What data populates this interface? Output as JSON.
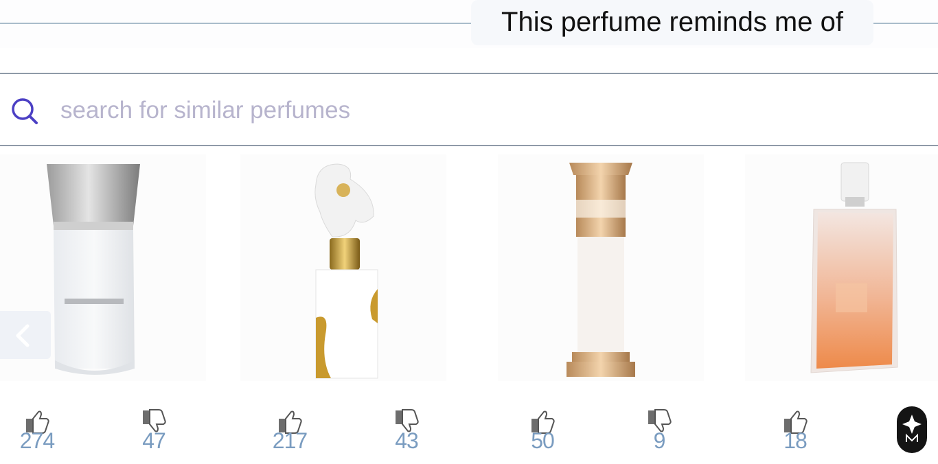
{
  "header": {
    "title": "This perfume reminds me of"
  },
  "search": {
    "placeholder": "search for similar perfumes",
    "value": ""
  },
  "perfumes": [
    {
      "image": "silver-cap-white-bottle",
      "votes": {
        "up": "274",
        "down": "47"
      }
    },
    {
      "image": "statue-gold-bottle",
      "votes": {
        "up": "217",
        "down": "43"
      }
    },
    {
      "image": "gold-pillar-bottle",
      "votes": {
        "up": "50",
        "down": "9"
      }
    },
    {
      "image": "orange-gradient-bottle",
      "votes": {
        "up": "18"
      }
    }
  ],
  "icons": {
    "search": "search-icon",
    "thumbs_up": "thumbs-up-icon",
    "thumbs_down": "thumbs-down-icon",
    "carousel_prev": "chevron-left-icon",
    "brand_logo": "brand-logo-icon"
  },
  "colors": {
    "accent": "#4b3fc4",
    "vote_count": "#7a9cc0",
    "placeholder": "#b7b4cd",
    "divider": "#a9bccb"
  }
}
